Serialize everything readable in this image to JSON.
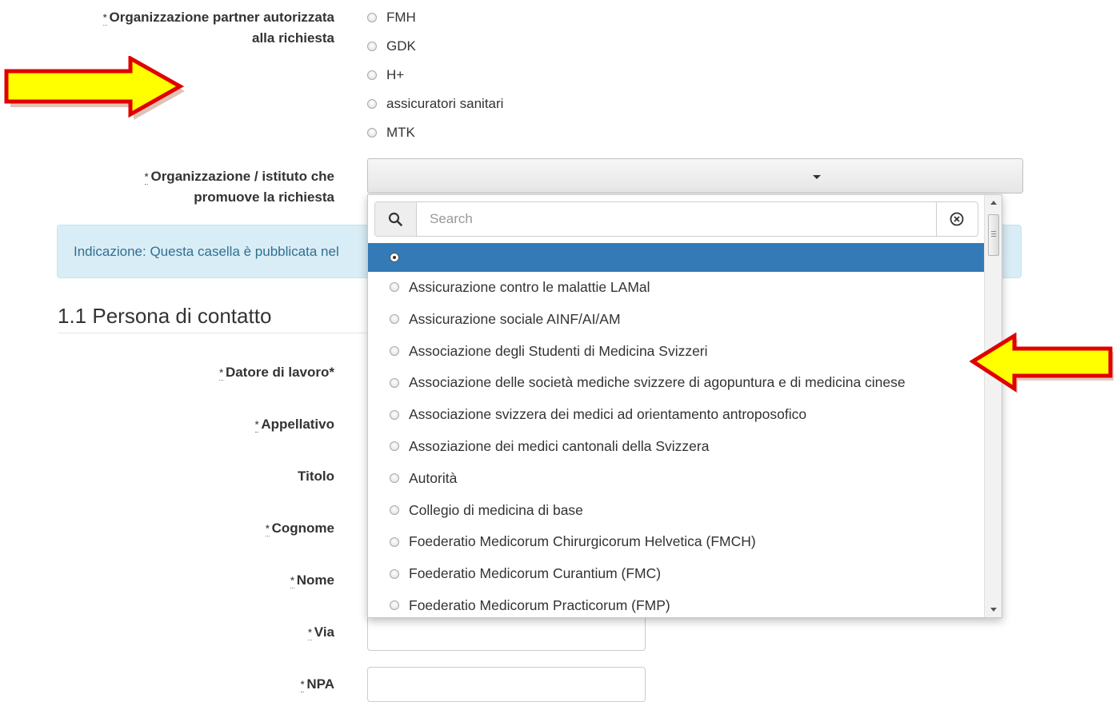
{
  "partner_org": {
    "required_mark": "*",
    "label_line1": "Organizzazione partner autorizzata",
    "label_line2": "alla richiesta",
    "options": [
      "FMH",
      "GDK",
      "H+",
      "assicuratori sanitari",
      "MTK"
    ]
  },
  "promoting_org": {
    "required_mark": "*",
    "label_line1": "Organizzazione / istituto che",
    "label_line2": "promuove la richiesta",
    "search_placeholder": "Search",
    "options": [
      "",
      "Assicurazione contro le malattie LAMal",
      "Assicurazione sociale AINF/AI/AM",
      "Associazione degli Studenti di Medicina Svizzeri",
      "Associazione delle società mediche svizzere di agopuntura e di medicina cinese",
      "Associazione svizzera dei medici ad orientamento antroposofico",
      "Assoziazione dei medici cantonali della Svizzera",
      "Autorità",
      "Collegio di medicina di base",
      "Foederatio Medicorum Chirurgicorum Helvetica (FMCH)",
      "Foederatio Medicorum Curantium (FMC)",
      "Foederatio Medicorum Practicorum (FMP)"
    ]
  },
  "info_text": "Indicazione: Questa casella è pubblicata nel",
  "section_title": "1.1 Persona di contatto",
  "fields": {
    "datore": {
      "req": "*",
      "label": "Datore di lavoro*"
    },
    "appellativo": {
      "req": "*",
      "label": "Appellativo"
    },
    "titolo": {
      "req": "",
      "label": "Titolo"
    },
    "cognome": {
      "req": "*",
      "label": "Cognome"
    },
    "nome": {
      "req": "*",
      "label": "Nome"
    },
    "via": {
      "req": "*",
      "label": "Via"
    },
    "npa": {
      "req": "*",
      "label": "NPA"
    }
  },
  "colors": {
    "selected_row": "#337ab7",
    "arrow_fill": "#ffff00",
    "arrow_stroke": "#e00000",
    "info_bg": "#d9edf7",
    "info_text": "#31708f"
  }
}
